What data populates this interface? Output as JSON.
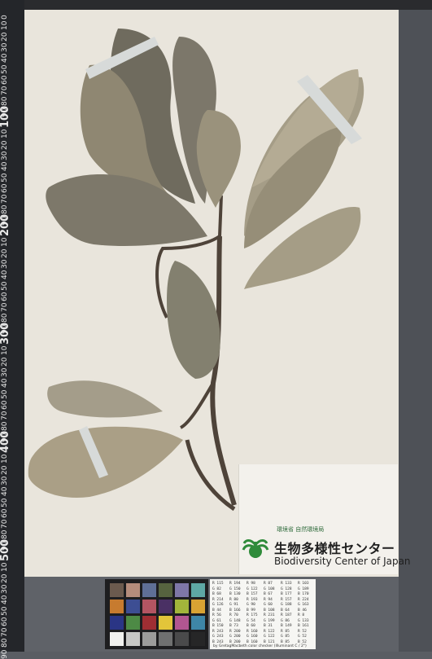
{
  "ruler": {
    "labels": [
      "0",
      "10",
      "20",
      "30",
      "40",
      "50",
      "60",
      "70",
      "80",
      "90",
      "100",
      "10",
      "20",
      "30",
      "40",
      "50",
      "60",
      "70",
      "80",
      "90",
      "200",
      "10",
      "20",
      "30",
      "40",
      "50",
      "60",
      "70",
      "80",
      "90",
      "300",
      "10",
      "20",
      "30",
      "40",
      "50",
      "60",
      "70",
      "80",
      "90",
      "400",
      "10",
      "20",
      "30",
      "40",
      "50",
      "60",
      "70",
      "80",
      "90",
      "500",
      "10",
      "20",
      "30",
      "40",
      "50",
      "60",
      "70",
      "80",
      "90"
    ],
    "unit": "mm"
  },
  "label": {
    "ministry": "環境省 自然環境局",
    "title_jp": "生物多様性センター",
    "title_en": "Biodiversity Center of Japan"
  },
  "color_card": {
    "swatches": [
      "#6b5a4e",
      "#b58d7c",
      "#5f6f96",
      "#56633f",
      "#7e77a7",
      "#5ea8a4",
      "#c77b2f",
      "#3d4e93",
      "#b45562",
      "#4a3064",
      "#a2b53b",
      "#d9a333",
      "#2a3585",
      "#4d8a45",
      "#9f2e33",
      "#e2c53a",
      "#b25691",
      "#3e86a7",
      "#f1f1ee",
      "#c8c8c6",
      "#9c9c9b",
      "#6f7070",
      "#4a4a4b",
      "#262627"
    ]
  },
  "patch_table": {
    "rows": [
      [
        "R 115",
        "R 194",
        "R 98",
        "R 87",
        "R 133",
        "R 103"
      ],
      [
        "G 82",
        "G 150",
        "G 122",
        "G 108",
        "G 128",
        "G 189"
      ],
      [
        "B 68",
        "B 130",
        "B 157",
        "B 67",
        "B 177",
        "B 170"
      ],
      [
        "R 214",
        "R 80",
        "R 193",
        "R 94",
        "R 157",
        "R 224"
      ],
      [
        "G 126",
        "G 91",
        "G 90",
        "G 60",
        "G 188",
        "G 163"
      ],
      [
        "B 44",
        "B 166",
        "B 99",
        "B 108",
        "B 64",
        "B 46"
      ],
      [
        "R 56",
        "R 70",
        "R 175",
        "R 231",
        "R 187",
        "R 8"
      ],
      [
        "G 61",
        "G 148",
        "G 54",
        "G 199",
        "G 86",
        "G 133"
      ],
      [
        "B 150",
        "B 73",
        "B 60",
        "B 31",
        "B 149",
        "B 161"
      ],
      [
        "R 243",
        "R 200",
        "R 160",
        "R 122",
        "R 85",
        "R 52"
      ],
      [
        "G 243",
        "G 200",
        "G 160",
        "G 122",
        "G 85",
        "G 52"
      ],
      [
        "B 243",
        "B 200",
        "B 160",
        "B 121",
        "B 85",
        "B 52"
      ]
    ],
    "note": "by GretagMacbeth color checker (Illuminant C / 2°)"
  }
}
